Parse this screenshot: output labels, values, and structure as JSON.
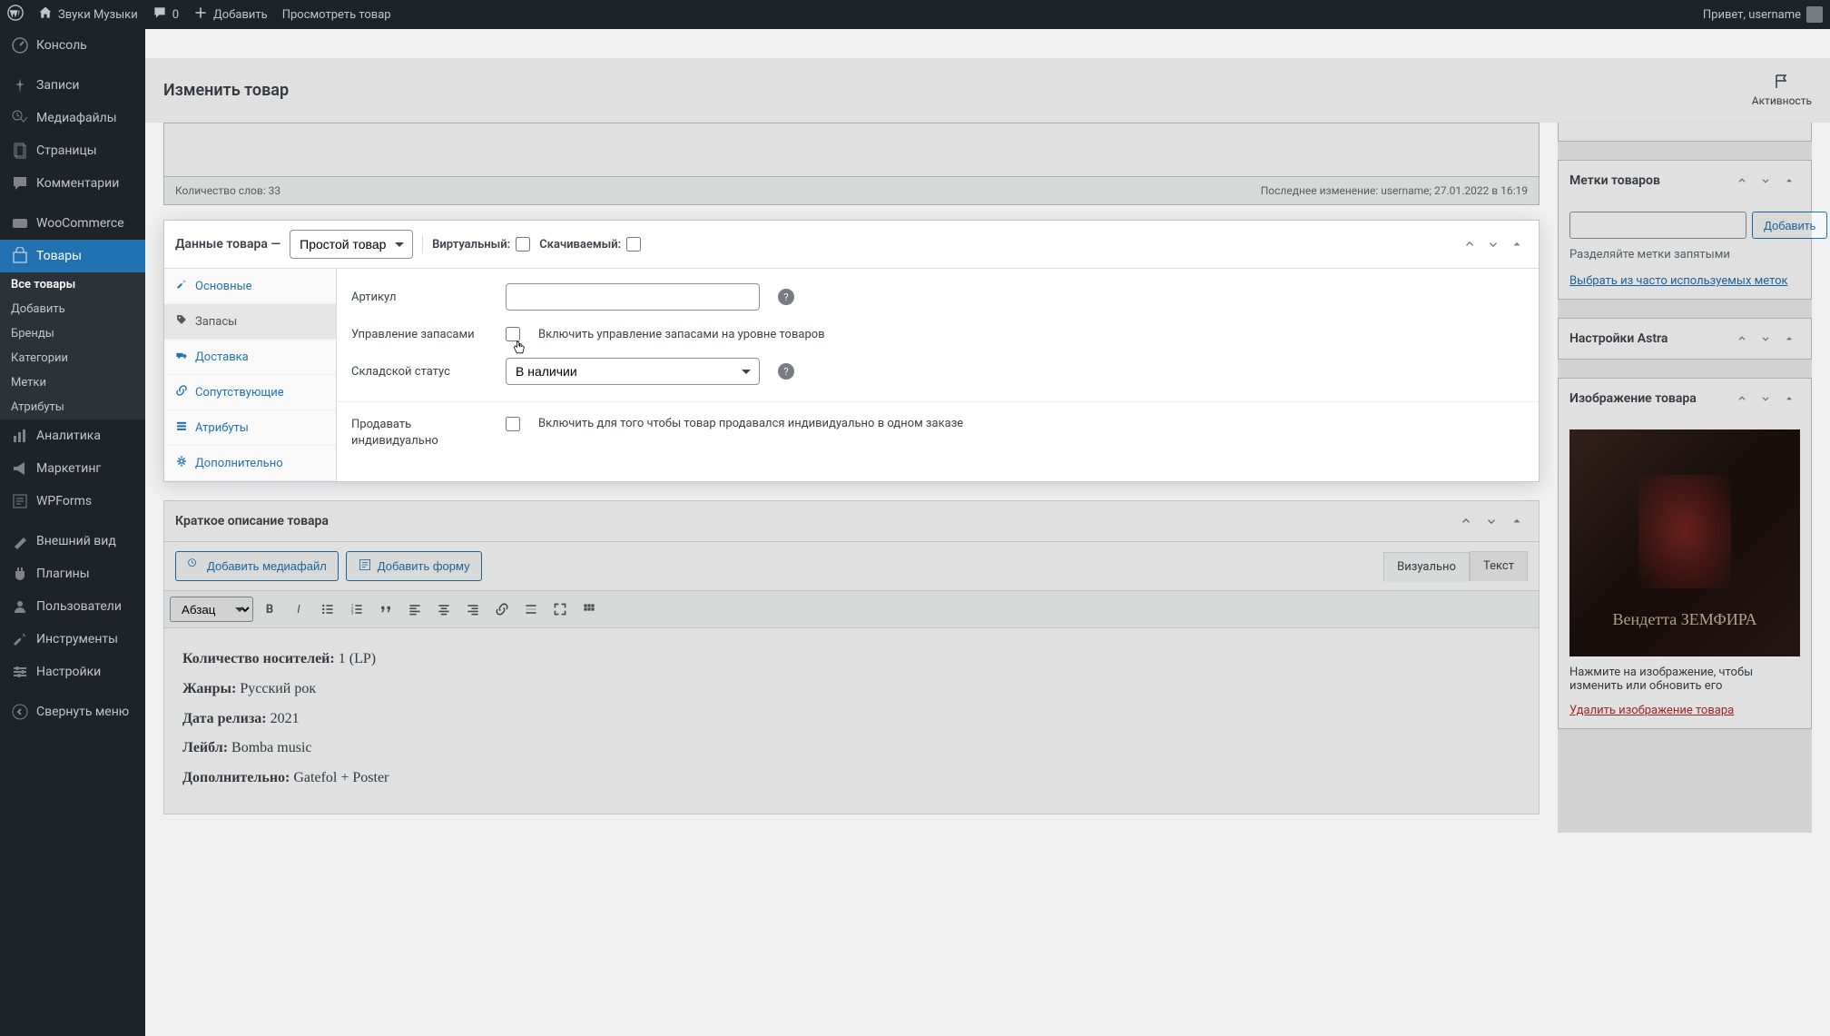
{
  "adminbar": {
    "site_name": "Звуки Музыки",
    "comments_count": "0",
    "add_new": "Добавить",
    "view_product": "Просмотреть товар",
    "greeting": "Привет, username"
  },
  "sidebar": {
    "items": [
      {
        "label": "Консоль",
        "icon": "dashboard"
      },
      {
        "label": "Записи",
        "icon": "pin"
      },
      {
        "label": "Медиафайлы",
        "icon": "media"
      },
      {
        "label": "Страницы",
        "icon": "pages"
      },
      {
        "label": "Комментарии",
        "icon": "comments"
      },
      {
        "label": "WooCommerce",
        "icon": "woo"
      },
      {
        "label": "Товары",
        "icon": "products",
        "active": true
      },
      {
        "label": "Аналитика",
        "icon": "analytics"
      },
      {
        "label": "Маркетинг",
        "icon": "marketing"
      },
      {
        "label": "WPForms",
        "icon": "forms"
      },
      {
        "label": "Внешний вид",
        "icon": "appearance"
      },
      {
        "label": "Плагины",
        "icon": "plugins"
      },
      {
        "label": "Пользователи",
        "icon": "users"
      },
      {
        "label": "Инструменты",
        "icon": "tools"
      },
      {
        "label": "Настройки",
        "icon": "settings"
      },
      {
        "label": "Свернуть меню",
        "icon": "collapse"
      }
    ],
    "sub_items": [
      "Все товары",
      "Добавить",
      "Бренды",
      "Категории",
      "Метки",
      "Атрибуты"
    ]
  },
  "header": {
    "title": "Изменить товар",
    "activity": "Активность"
  },
  "word_count": {
    "label": "Количество слов: 33",
    "last_edit": "Последнее изменение: username; 27.01.2022 в 16:19"
  },
  "product_data": {
    "title": "Данные товара —",
    "type_options": [
      "Простой товар"
    ],
    "virtual_label": "Виртуальный:",
    "downloadable_label": "Скачиваемый:",
    "tabs": [
      "Основные",
      "Запасы",
      "Доставка",
      "Сопутствующие",
      "Атрибуты",
      "Дополнительно"
    ],
    "fields": {
      "sku_label": "Артикул",
      "stock_mgmt_label": "Управление запасами",
      "stock_mgmt_checkbox": "Включить управление запасами на уровне товаров",
      "stock_status_label": "Складской статус",
      "stock_status_value": "В наличии",
      "sold_individually_label": "Продавать индивидуально",
      "sold_individually_checkbox": "Включить для того чтобы товар продавался индивидуально в одном заказе"
    }
  },
  "short_desc": {
    "title": "Краткое описание товара",
    "add_media": "Добавить медиафайл",
    "add_form": "Добавить форму",
    "tab_visual": "Визуально",
    "tab_text": "Текст",
    "format": "Абзац",
    "content": [
      {
        "label": "Количество носителей:",
        "value": "1 (LP)"
      },
      {
        "label": "Жанры:",
        "value": "Русский рок"
      },
      {
        "label": "Дата релиза:",
        "value": "2021"
      },
      {
        "label": "Лейбл:",
        "value": "Bomba music"
      },
      {
        "label": "Дополнительно:",
        "value": "Gatefol + Poster"
      }
    ]
  },
  "side": {
    "tags": {
      "title": "Метки товаров",
      "add_btn": "Добавить",
      "separator_hint": "Разделяйте метки запятыми",
      "choose_link": "Выбрать из часто используемых меток"
    },
    "astra": {
      "title": "Настройки Astra"
    },
    "image": {
      "title": "Изображение товара",
      "overlay_text": "Вендетта ЗЕМФИРА",
      "hint": "Нажмите на изображение, чтобы изменить или обновить его",
      "delete_link": "Удалить изображение товара"
    }
  }
}
